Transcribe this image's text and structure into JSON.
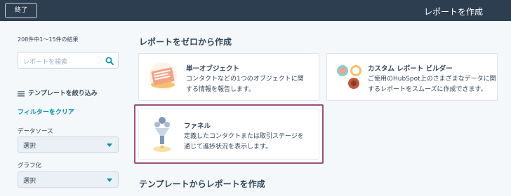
{
  "header": {
    "exit_label": "終了",
    "title": "レポートを作成"
  },
  "sidebar": {
    "results_text": "208件中1〜15件の結果",
    "search_placeholder": "レポートを検索",
    "filter_heading": "テンプレートを絞り込み",
    "clear_filter": "フィルターをクリア",
    "data_source_label": "データソース",
    "data_source_value": "選択",
    "chart_type_label": "グラフ化",
    "chart_type_value": "選択"
  },
  "main": {
    "scratch_title": "レポートをゼロから作成",
    "templates_title": "テンプレートからレポートを作成",
    "cards": [
      {
        "title": "単一オブジェクト",
        "desc_line1": "コンタクトなどの1つのオブジェクトに関",
        "desc_line2": "する情報を報告します。"
      },
      {
        "title": "カスタム レポート ビルダー",
        "desc_line1": "ご使用のHubSpot上のさまざまなデータに関",
        "desc_line2": "するレポートをスムーズに作成できます。"
      },
      {
        "title": "ファネル",
        "desc_line1": "定義したコンタクトまたは取引ステージを",
        "desc_line2": "通じて進捗状況を表示します。"
      }
    ]
  },
  "colors": {
    "topbar": "#2d3e50",
    "accent_link": "#0091ae",
    "highlight_border": "#9b4f7d"
  }
}
